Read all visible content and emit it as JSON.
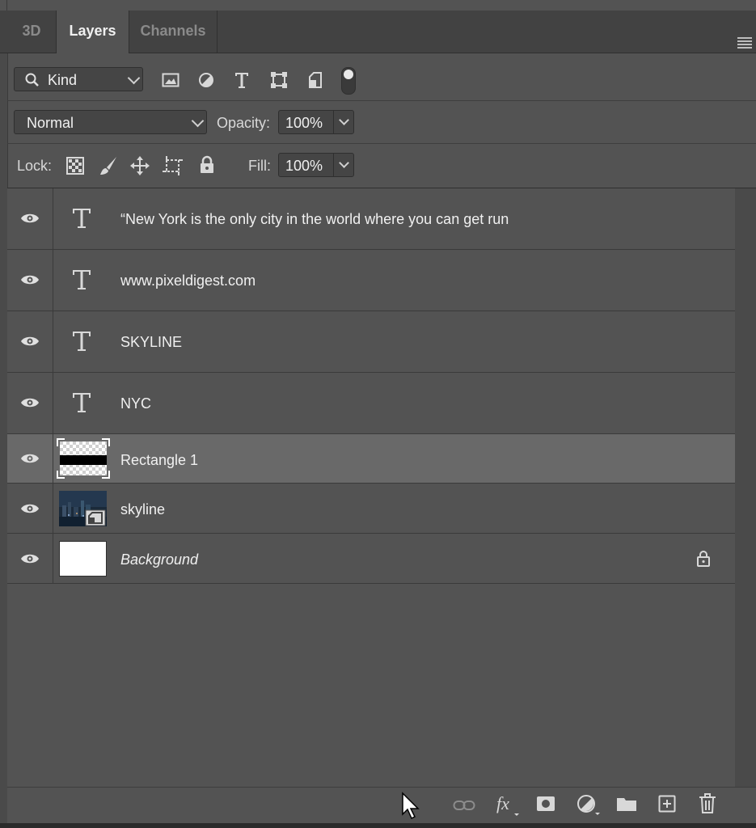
{
  "tabs": [
    {
      "label": "3D",
      "active": false
    },
    {
      "label": "Layers",
      "active": true
    },
    {
      "label": "Channels",
      "active": false
    }
  ],
  "filter": {
    "kind_label": "Kind",
    "icons": [
      "image-filter-icon",
      "adjustment-filter-icon",
      "type-filter-icon",
      "shape-filter-icon",
      "smart-object-filter-icon",
      "filter-toggle-icon"
    ]
  },
  "blend": {
    "mode": "Normal",
    "opacity_label": "Opacity:",
    "opacity_value": "100%"
  },
  "lock": {
    "label": "Lock:",
    "icons": [
      "lock-transparent-icon",
      "lock-pixels-icon",
      "lock-position-icon",
      "lock-artboard-icon",
      "lock-all-icon"
    ],
    "fill_label": "Fill:",
    "fill_value": "100%"
  },
  "layers": [
    {
      "name": "“New York is the only city in  the world where you can get run",
      "kind": "text",
      "selected": false,
      "italic": false
    },
    {
      "name": "www.pixeldigest.com",
      "kind": "text",
      "selected": false,
      "italic": false
    },
    {
      "name": "SKYLINE",
      "kind": "text",
      "selected": false,
      "italic": false
    },
    {
      "name": "NYC",
      "kind": "text",
      "selected": false,
      "italic": false
    },
    {
      "name": "Rectangle 1",
      "kind": "shape",
      "selected": true,
      "italic": false
    },
    {
      "name": "skyline",
      "kind": "smart-object",
      "selected": false,
      "italic": false
    },
    {
      "name": "Background",
      "kind": "background",
      "selected": false,
      "italic": true,
      "locked": true
    }
  ],
  "footer_icons": [
    "link-layers-icon",
    "fx-icon",
    "add-mask-icon",
    "adjustment-layer-icon",
    "new-group-icon",
    "new-layer-icon",
    "delete-icon"
  ],
  "colors": {
    "panel": "#535353",
    "selected_row": "#696969",
    "text": "#f0f0f0"
  }
}
